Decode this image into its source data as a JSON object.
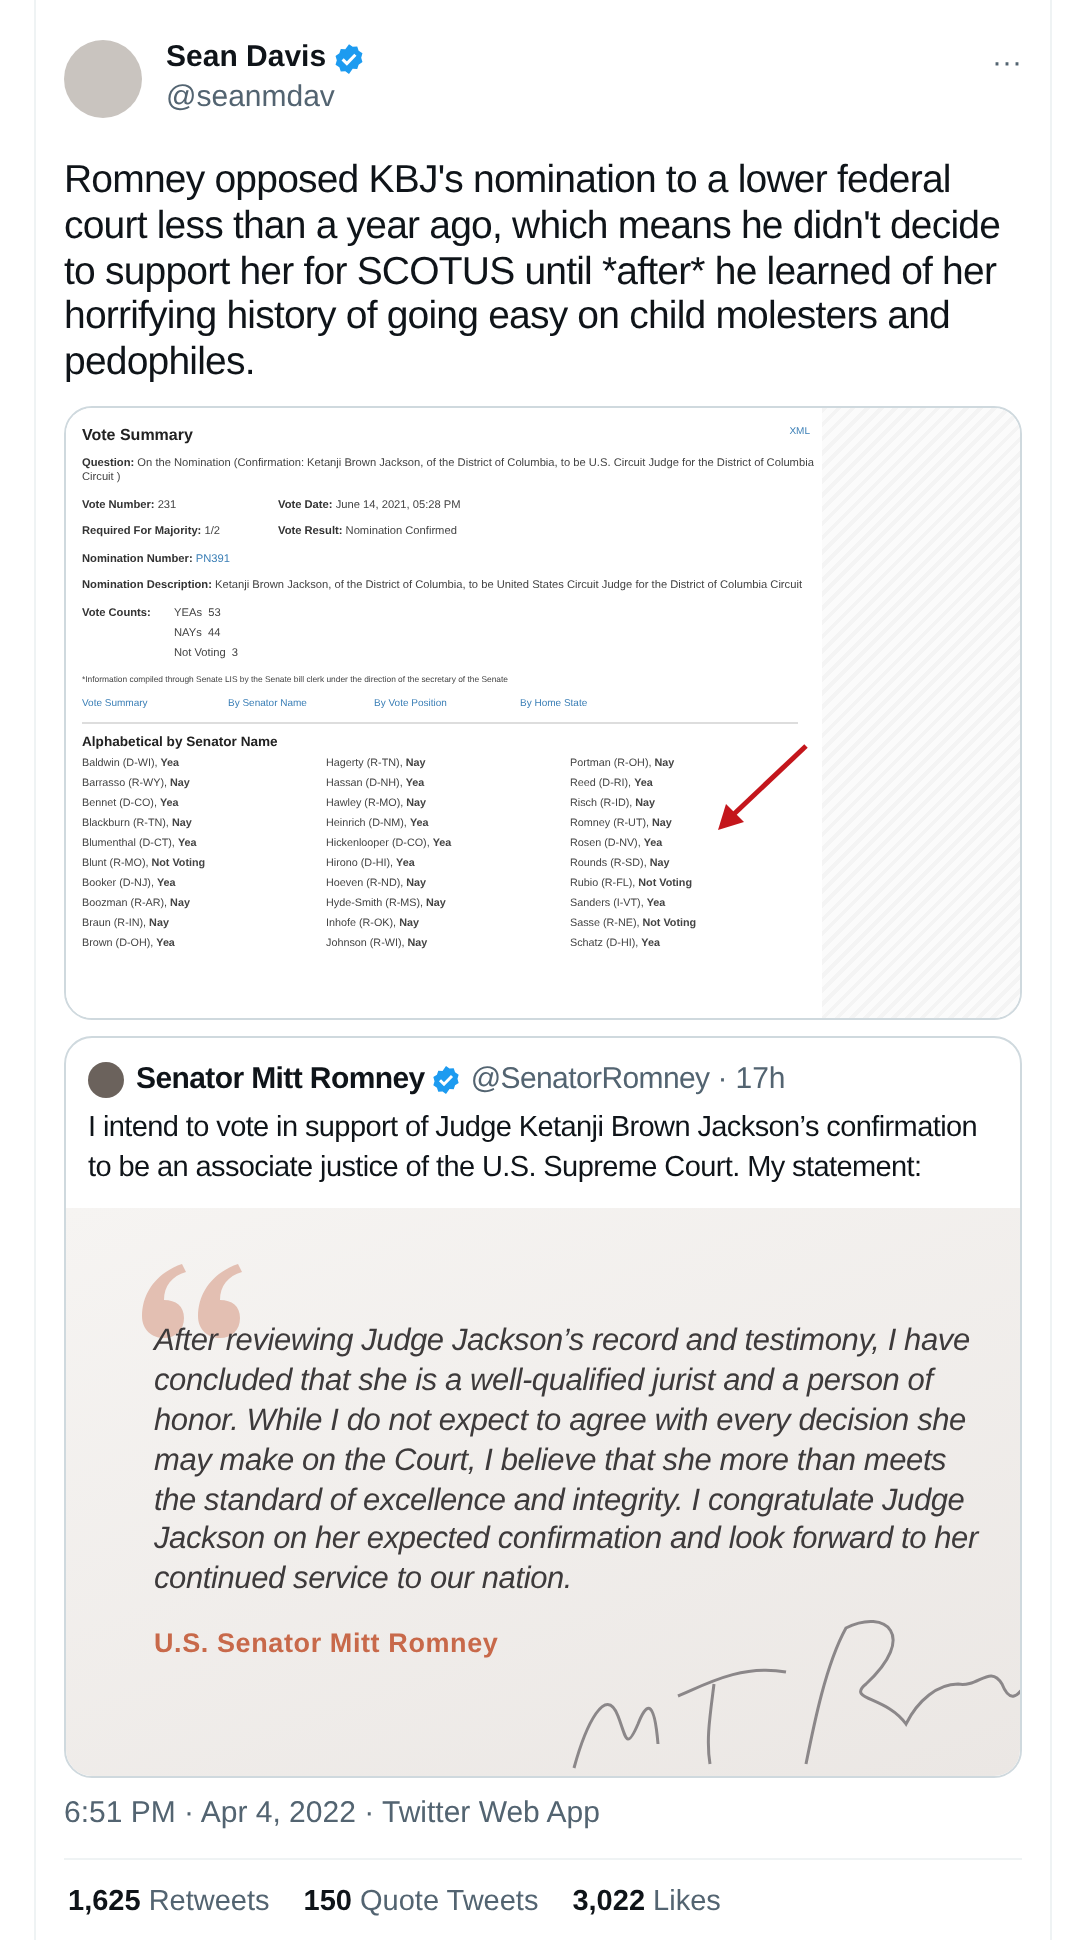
{
  "tweet": {
    "author": {
      "name": "Sean Davis",
      "handle": "@seanmdav",
      "verified": true
    },
    "text": "Romney opposed KBJ's nomination to a lower federal court less than a year ago, which means he didn't decide to support her for SCOTUS until *after* he learned of her horrifying history of going easy on child molesters and pedophiles.",
    "more_button": "···",
    "vote_summary": {
      "title": "Vote Summary",
      "xml_link": "XML",
      "rows": [
        [
          {
            "label": "Question:",
            "value": "On the Nomination (Confirmation: Ketanji Brown Jackson, of the District of Columbia, to be U.S. Circuit Judge for the District of Columbia Circuit )",
            "link": false
          }
        ],
        [
          {
            "label": "Vote Number:",
            "value": "231",
            "link": false
          },
          {
            "label": "Vote Date:",
            "value": "June 14, 2021, 05:28 PM",
            "link": false
          }
        ],
        [
          {
            "label": "Required For Majority:",
            "value": "1/2",
            "link": false
          },
          {
            "label": "Vote Result:",
            "value": "Nomination Confirmed",
            "link": false
          }
        ],
        [
          {
            "label": "Nomination Number:",
            "value": "PN391",
            "link": true
          }
        ],
        [
          {
            "label": "Nomination Description:",
            "value": "Ketanji Brown Jackson, of the District of Columbia, to be United States Circuit Judge for the District of Columbia Circuit",
            "link": false
          }
        ]
      ],
      "vote_counts": {
        "label": "Vote Counts:",
        "items": [
          {
            "label": "YEAs",
            "value": "53"
          },
          {
            "label": "NAYs",
            "value": "44"
          },
          {
            "label": "Not Voting",
            "value": "3"
          }
        ]
      },
      "footnote": "*Information compiled through Senate LIS by the Senate bill clerk under the direction of the secretary of the Senate",
      "tabs": [
        "Vote Summary",
        "By Senator Name",
        "By Vote Position",
        "By Home State"
      ],
      "list_title": "Alphabetical by Senator Name",
      "senator_rows": [
        [
          "Baldwin (D-WI), **Yea**",
          "Hagerty (R-TN), **Nay**",
          "Portman (R-OH), **Nay**"
        ],
        [
          "Barrasso (R-WY), **Nay**",
          "Hassan (D-NH), **Yea**",
          "Reed (D-RI), **Yea**"
        ],
        [
          "Bennet (D-CO), **Yea**",
          "Hawley (R-MO), **Nay**",
          "Risch (R-ID), **Nay**"
        ],
        [
          "Blackburn (R-TN), **Nay**",
          "Heinrich (D-NM), **Yea**",
          "Romney (R-UT), **Nay**"
        ],
        [
          "Blumenthal (D-CT), **Yea**",
          "Hickenlooper (D-CO), **Yea**",
          "Rosen (D-NV), **Yea**"
        ],
        [
          "Blunt (R-MO), **Not Voting**",
          "Hirono (D-HI), **Yea**",
          "Rounds (R-SD), **Nay**"
        ],
        [
          "Booker (D-NJ), **Yea**",
          "Hoeven (R-ND), **Nay**",
          "Rubio (R-FL), **Not Voting**"
        ],
        [
          "Boozman (R-AR), **Nay**",
          "Hyde-Smith (R-MS), **Nay**",
          "Sanders (I-VT), **Yea**"
        ],
        [
          "Braun (R-IN), **Nay**",
          "Inhofe (R-OK), **Nay**",
          "Sasse (R-NE), **Not Voting**"
        ],
        [
          "Brown (D-OH), **Yea**",
          "Johnson (R-WI), **Nay**",
          "Schatz (D-HI), **Yea**"
        ]
      ]
    },
    "quoted_tweet": {
      "author": {
        "name": "Senator Mitt Romney",
        "handle": "@SenatorRomney",
        "verified": true
      },
      "separator": "·",
      "time": "17h",
      "text": "I intend to vote in support of Judge Ketanji Brown Jackson’s confirmation to be an associate justice of the U.S. Supreme Court. My statement:",
      "statement": {
        "text": "After reviewing Judge Jackson’s record and testimony, I have concluded that she is a well-qualified jurist and a person of honor. While I do not expect to agree with every decision she may make on the Court, I believe that she more than meets the standard of excellence and integrity. I congratulate Judge Jackson on her expected confirmation and look forward to her continued service to our nation.",
        "signature": "U.S. Senator Mitt Romney"
      }
    },
    "timestamp": "6:51 PM · Apr 4, 2022 · Twitter Web App",
    "stats": [
      {
        "count": "1,625",
        "label": "Retweets"
      },
      {
        "count": "150",
        "label": "Quote Tweets"
      },
      {
        "count": "3,022",
        "label": "Likes"
      }
    ]
  }
}
